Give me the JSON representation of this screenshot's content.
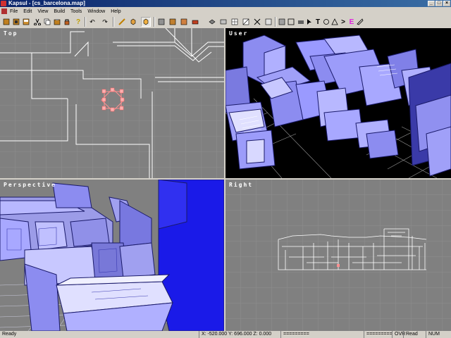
{
  "window": {
    "title": "Kapsul - [cs_barcelona.map]"
  },
  "menu": [
    "File",
    "Edit",
    "View",
    "Build",
    "Tools",
    "Window",
    "Help"
  ],
  "toolbar": {
    "icons": [
      "new-file-icon",
      "open-file-icon",
      "save-icon",
      "cut-icon",
      "copy-icon",
      "paste-icon",
      "lock-icon",
      "help-icon",
      "undo-icon",
      "redo-icon",
      "brush-tool-icon",
      "cube-icon",
      "wireframe-icon",
      "flat-shade-icon",
      "texture-icon",
      "light-icon",
      "entity-icon",
      "group-icon",
      "mirror-icon",
      "grid-icon",
      "snap-icon",
      "clip-icon",
      "vertex-icon",
      "face-icon",
      "hollow-icon",
      "camera-icon",
      "select-icon",
      "edge-icon",
      "scale-icon",
      "rotate-icon",
      "text-tool-icon",
      "move-icon",
      "polygon-icon",
      "arrow-icon",
      "entity-e-icon",
      "compile-icon"
    ],
    "text_tool_glyph": "T",
    "arrow_glyph": ">",
    "entity_glyph": "E"
  },
  "viewports": [
    {
      "label": "Top",
      "view": "2D top wireframe"
    },
    {
      "label": "User",
      "view": "3D flat-shaded"
    },
    {
      "label": "Perspective",
      "view": "3D perspective"
    },
    {
      "label": "Right",
      "view": "2D side wireframe"
    }
  ],
  "status": {
    "ready": "Ready",
    "coords": "X: -520.000 Y: 696.000 Z:   0.000",
    "progress_left": "=========",
    "progress_right": "=========",
    "ovr": "OVR",
    "read": "Read",
    "num": "NUM"
  },
  "colors": {
    "viewport_bg": "#808080",
    "brush": "#8c8cf0",
    "brush_dark": "#3a3aa8",
    "wire": "#ffffff",
    "selection": "#ff9090",
    "bright_blue": "#1a1ae8"
  }
}
